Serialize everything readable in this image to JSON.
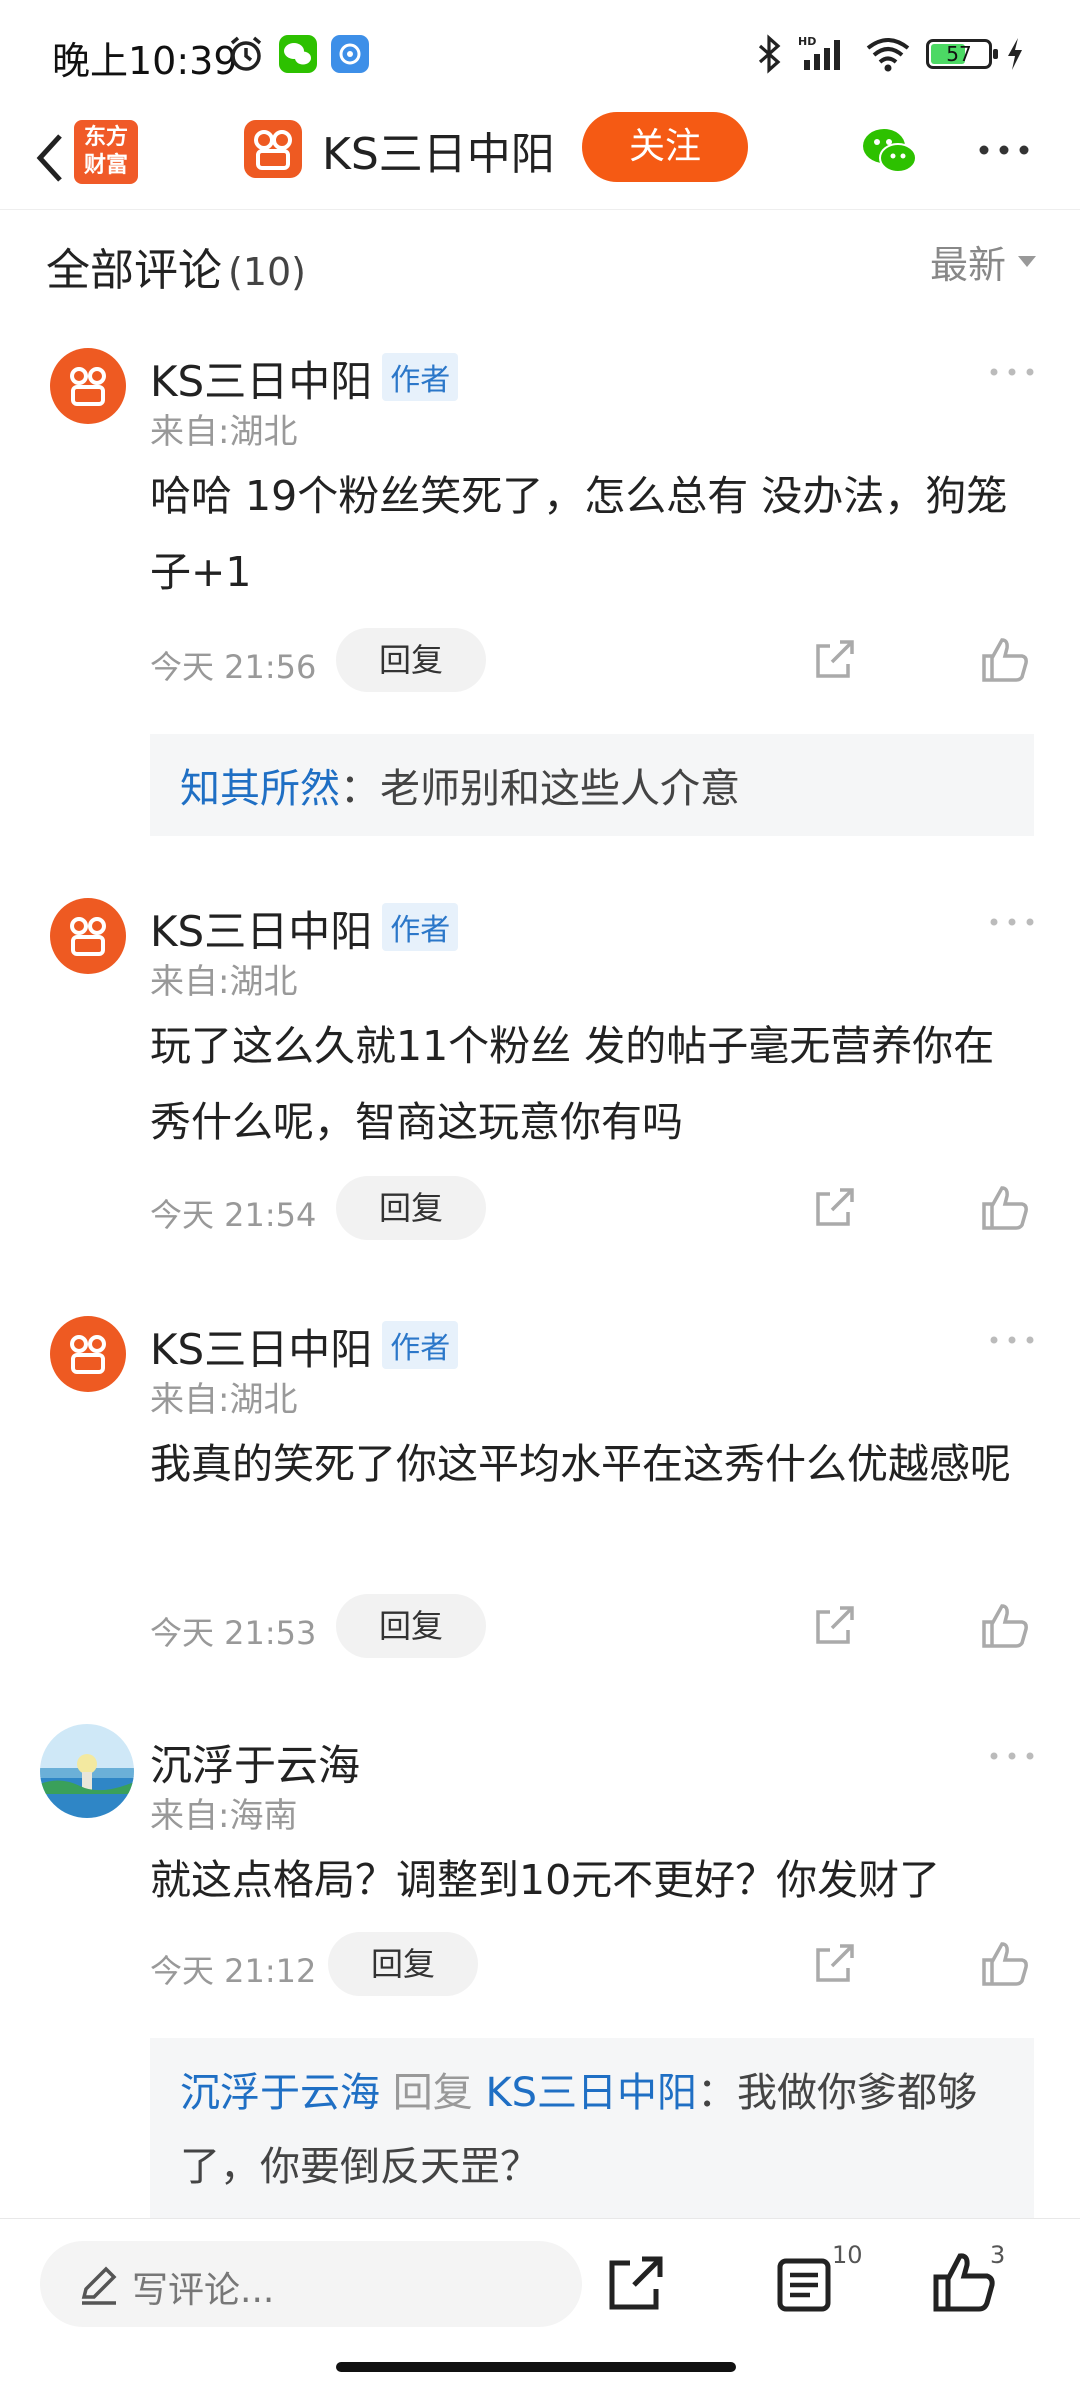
{
  "status_bar": {
    "time": "晚上10:39",
    "battery": "57"
  },
  "nav": {
    "app_logo_line1": "东方",
    "app_logo_line2": "财富",
    "title": "KS三日中阳",
    "follow_label": "关注"
  },
  "list_header": {
    "title": "全部评论",
    "count": "(10)",
    "sort_label": "最新"
  },
  "comments": [
    {
      "name": "KS三日中阳",
      "badge": "作者",
      "location": "来自:湖北",
      "text": "哈哈 19个粉丝笑死了，怎么总有 没办法，狗笼子+1",
      "time": "今天 21:56",
      "reply_label": "回复",
      "sub_reply": {
        "name": "知其所然",
        "text": "：老师别和这些人介意"
      }
    },
    {
      "name": "KS三日中阳",
      "badge": "作者",
      "location": "来自:湖北",
      "text": "玩了这么久就11个粉丝 发的帖子毫无营养你在秀什么呢，智商这玩意你有吗",
      "time": "今天 21:54",
      "reply_label": "回复"
    },
    {
      "name": "KS三日中阳",
      "badge": "作者",
      "location": "来自:湖北",
      "text": "我真的笑死了你这平均水平在这秀什么优越感呢",
      "time": "今天 21:53",
      "reply_label": "回复"
    },
    {
      "name": "沉浮于云海",
      "location": "来自:海南",
      "text": "就这点格局？调整到10元不更好？你发财了",
      "time": "今天 21:12",
      "reply_label": "回复",
      "sub_reply": {
        "name": "沉浮于云海",
        "verb": "回复",
        "target": "KS三日中阳",
        "text": "：我做你爹都够了，你要倒反天罡？"
      }
    }
  ],
  "bottom_bar": {
    "write_placeholder": "写评论...",
    "comments_count": "10",
    "likes_count": "3"
  },
  "colors": {
    "accent": "#f55a14",
    "link": "#1f6fc4",
    "badge_bg": "#e7f1fb"
  }
}
